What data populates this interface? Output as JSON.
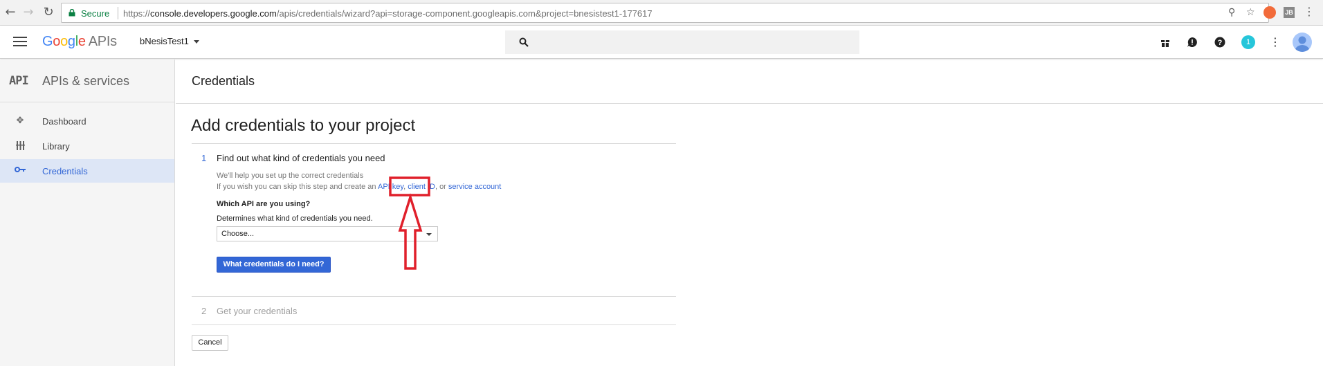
{
  "browser": {
    "secure_label": "Secure",
    "url_scheme": "https://",
    "url_host": "console.developers.google.com",
    "url_rest": "/apis/credentials/wizard?api=storage-component.googleapis.com&project=bnesistest1-177617",
    "extension_label": "JB"
  },
  "header": {
    "logo_google": [
      "G",
      "o",
      "o",
      "g",
      "l",
      "e"
    ],
    "logo_suffix": "APIs",
    "project_name": "bNesisTest1",
    "notification_count": "1"
  },
  "sidebar": {
    "title": "APIs & services",
    "api_mark": "API",
    "items": [
      {
        "label": "Dashboard",
        "icon": "dashboard-icon",
        "active": false
      },
      {
        "label": "Library",
        "icon": "library-icon",
        "active": false
      },
      {
        "label": "Credentials",
        "icon": "key-icon",
        "active": true
      }
    ]
  },
  "page": {
    "title": "Credentials",
    "heading": "Add credentials to your project",
    "step1": {
      "number": "1",
      "title": "Find out what kind of credentials you need",
      "help_line1": "We'll help you set up the correct credentials",
      "help_line2_prefix": "If you wish you can skip this step and create an",
      "link_api_key": "API key",
      "link_sep1": ",",
      "link_client_id": "client ID",
      "link_sep2": ", or",
      "link_service_account": "service account",
      "field_label": "Which API are you using?",
      "field_desc": "Determines what kind of credentials you need.",
      "select_value": "Choose...",
      "button_label": "What credentials do I need?"
    },
    "step2": {
      "number": "2",
      "title": "Get your credentials"
    },
    "cancel_label": "Cancel"
  },
  "colors": {
    "accent": "#3367d6",
    "annotation": "#e0202b",
    "sidebar_active_bg": "#dde6f6"
  }
}
